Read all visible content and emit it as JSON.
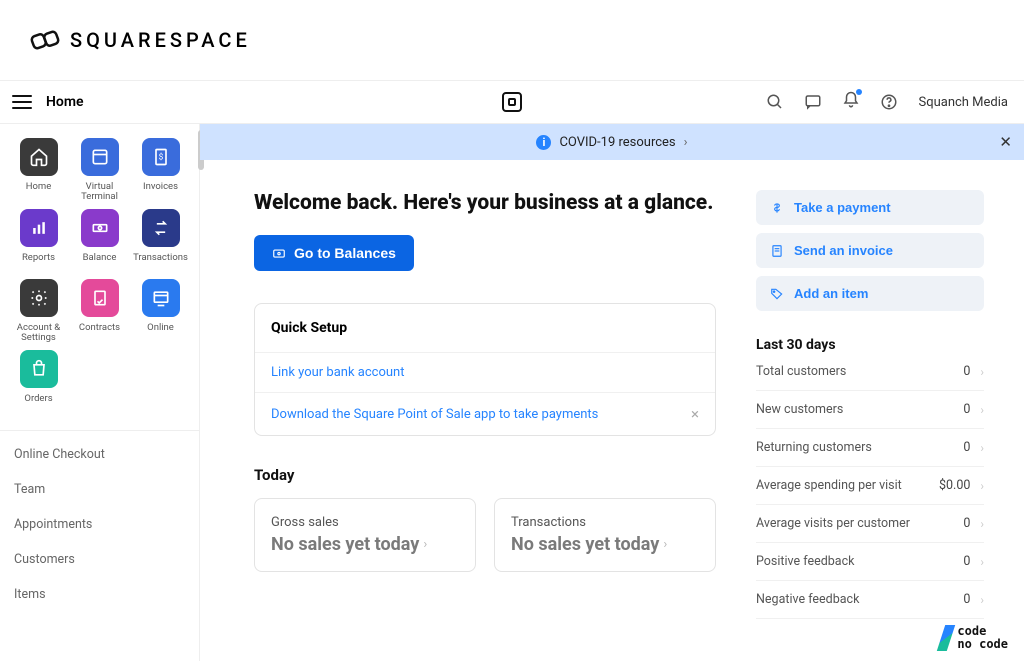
{
  "brand": "SQUARESPACE",
  "header": {
    "title": "Home",
    "account_name": "Squanch Media"
  },
  "banner": {
    "text": "COVID-19 resources"
  },
  "sidebar": {
    "tiles": [
      {
        "label": "Home"
      },
      {
        "label": "Virtual Terminal"
      },
      {
        "label": "Invoices"
      },
      {
        "label": "Reports"
      },
      {
        "label": "Balance"
      },
      {
        "label": "Transactions"
      },
      {
        "label": "Account & Settings"
      },
      {
        "label": "Contracts"
      },
      {
        "label": "Online"
      },
      {
        "label": "Orders"
      }
    ],
    "links": [
      "Online Checkout",
      "Team",
      "Appointments",
      "Customers",
      "Items"
    ]
  },
  "welcome": {
    "heading": "Welcome back. Here's your business at a glance.",
    "cta": "Go to Balances"
  },
  "actions": {
    "take_payment": "Take a payment",
    "send_invoice": "Send an invoice",
    "add_item": "Add an item"
  },
  "quick_setup": {
    "title": "Quick Setup",
    "rows": [
      "Link your bank account",
      "Download the Square Point of Sale app to take payments"
    ]
  },
  "today": {
    "title": "Today",
    "cards": [
      {
        "label": "Gross sales",
        "value": "No sales yet today"
      },
      {
        "label": "Transactions",
        "value": "No sales yet today"
      }
    ]
  },
  "stats": {
    "title": "Last 30 days",
    "rows": [
      {
        "label": "Total customers",
        "value": "0"
      },
      {
        "label": "New customers",
        "value": "0"
      },
      {
        "label": "Returning customers",
        "value": "0"
      },
      {
        "label": "Average spending per visit",
        "value": "$0.00"
      },
      {
        "label": "Average visits per customer",
        "value": "0"
      },
      {
        "label": "Positive feedback",
        "value": "0"
      },
      {
        "label": "Negative feedback",
        "value": "0"
      }
    ]
  },
  "watermark": {
    "line1": "code",
    "line2": "no code"
  }
}
